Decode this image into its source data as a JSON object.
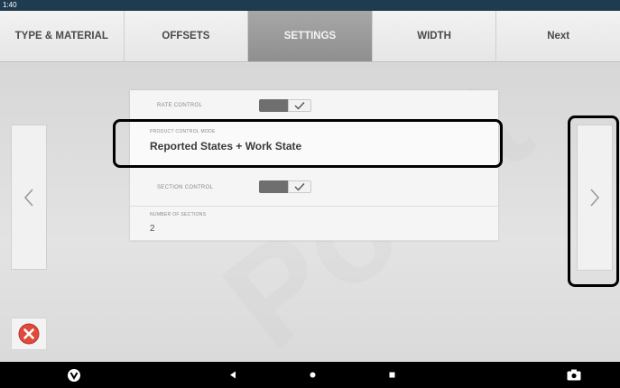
{
  "status_bar": {
    "time": "1:40"
  },
  "tabs": [
    {
      "label": "TYPE & MATERIAL",
      "active": false
    },
    {
      "label": "OFFSETS",
      "active": false
    },
    {
      "label": "SETTINGS",
      "active": true
    },
    {
      "label": "WIDTH",
      "active": false
    },
    {
      "label": "Next",
      "active": false
    }
  ],
  "settings": {
    "rate_control": {
      "label": "RATE CONTROL",
      "enabled": true
    },
    "mode": {
      "label": "PRODUCT CONTROL MODE",
      "value": "Reported States + Work State"
    },
    "section_control": {
      "label": "SECTION CONTROL",
      "enabled": true
    },
    "sections": {
      "label": "NUMBER OF SECTIONS",
      "value": "2"
    }
  },
  "watermark_text": "Point",
  "colors": {
    "active_tab": "#9a9a9a",
    "toggle_on": "#6f6f6f",
    "cancel_red": "#e04a3c",
    "nav_bar": "#000000",
    "status_bar": "#1f3b4f"
  },
  "icons": {
    "prev": "chevron-left-icon",
    "next": "chevron-right-icon",
    "cancel": "cancel-x-icon",
    "check": "check-icon",
    "app": "app-logo-icon",
    "back": "back-triangle-icon",
    "home": "home-dot-icon",
    "recents": "recents-square-icon",
    "camera": "camera-icon"
  }
}
